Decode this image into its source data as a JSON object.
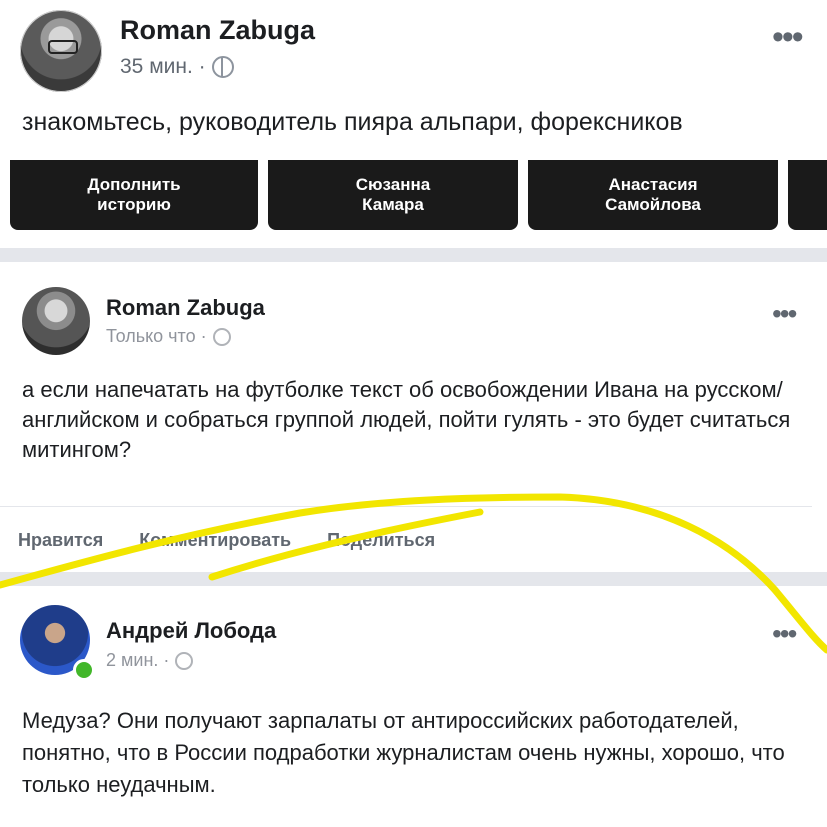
{
  "post_top": {
    "author": "Roman Zabuga",
    "time": "35 мин. ·",
    "text": "знакомьтесь, руководитель пияра альпари, форексников",
    "more_icon": "more-dots-icon"
  },
  "stories": [
    {
      "label": "Дополнить историю"
    },
    {
      "label": "Сюзанна Камара"
    },
    {
      "label": "Анастасия Самойлова"
    }
  ],
  "post_mid": {
    "author": "Roman Zabuga",
    "time": "Только что ·",
    "text": "а если напечатать на футболке текст об освобождении Ивана на русском/английском и собраться группой людей, пойти гулять - это будет считаться митингом?",
    "actions": {
      "like": "Нравится",
      "comment": "Комментировать",
      "share": "Поделиться"
    }
  },
  "post_bot": {
    "author": "Андрей Лобода",
    "time": "2 мин. ·",
    "text": "Медуза? Они получают зарпалаты от антироссийских работодателей, понятно, что в России подработки журналистам очень нужны, хорошо, что только неудачным."
  },
  "colors": {
    "highlight": "#f2e600",
    "separator": "#e4e6eb",
    "online": "#42b72a"
  }
}
